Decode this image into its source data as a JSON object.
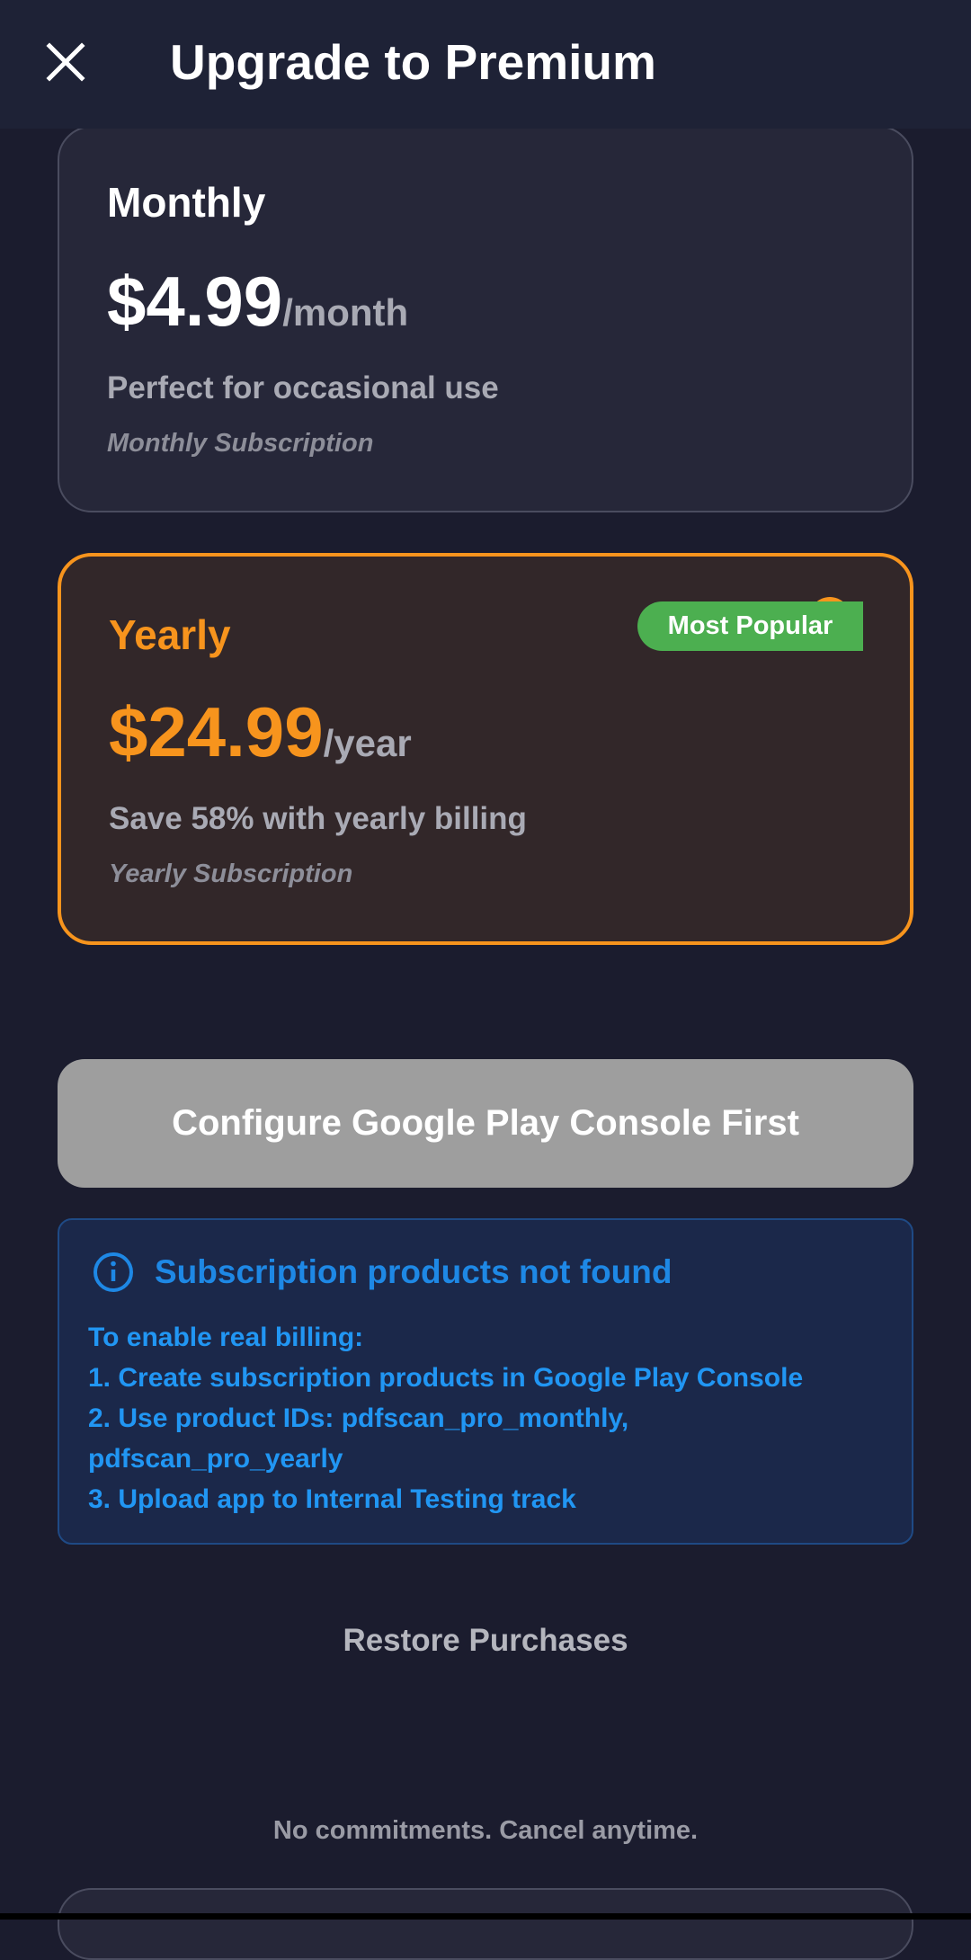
{
  "header": {
    "title": "Upgrade to Premium",
    "close_icon": "close-icon"
  },
  "plans": [
    {
      "name": "Monthly",
      "price": "$4.99",
      "period": "/month",
      "description": "Perfect for occasional use",
      "product_title": "Monthly Subscription",
      "selected": false
    },
    {
      "name": "Yearly",
      "price": "$24.99",
      "period": "/year",
      "description": "Save 58% with yearly billing",
      "product_title": "Yearly Subscription",
      "badge": "Most Popular",
      "selected": true
    }
  ],
  "cta": {
    "label": "Configure Google Play Console First",
    "enabled": false
  },
  "notice": {
    "icon": "info-icon",
    "title": "Subscription products not found",
    "lines": [
      "To enable real billing:",
      "1. Create subscription products in Google Play Console",
      "2. Use product IDs: pdfscan_pro_monthly,",
      "pdfscan_pro_yearly",
      "3. Upload app to Internal Testing track"
    ]
  },
  "restore": {
    "label": "Restore Purchases"
  },
  "footer": {
    "note": "No commitments. Cancel anytime."
  },
  "colors": {
    "background": "#1b1c2e",
    "accent": "#f7941d",
    "badge": "#4caf50",
    "info": "#2196f3",
    "disabled_button": "#9e9e9e"
  }
}
